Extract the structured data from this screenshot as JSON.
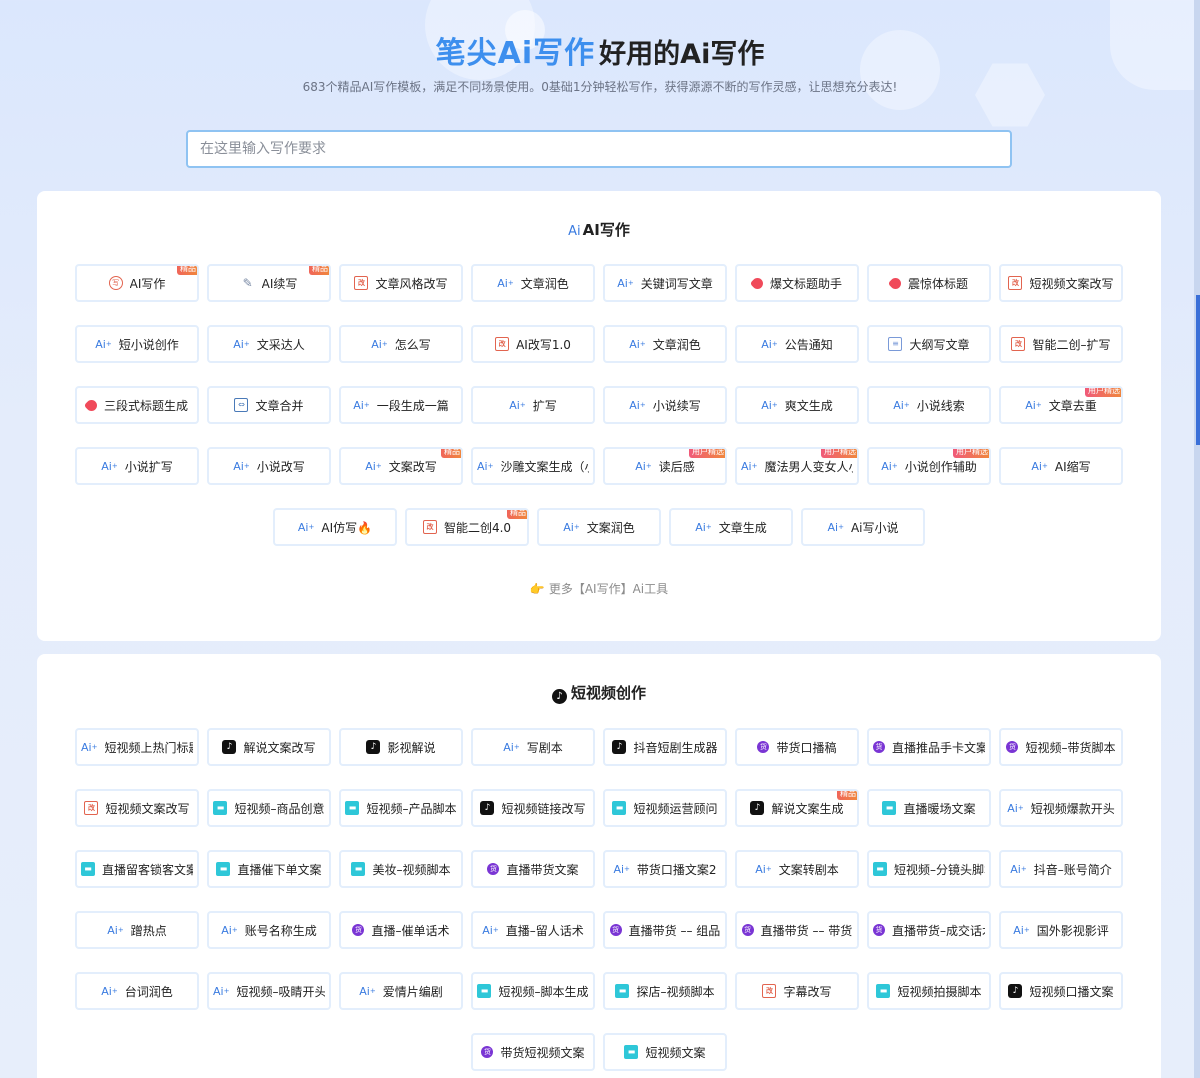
{
  "header": {
    "brand": "笔尖Ai写作",
    "title_rest": "好用的Ai写作",
    "subtitle": "683个精品AI写作模板，满足不同场景使用。0基础1分钟轻松写作，获得源源不断的写作灵感，让思想充分表达!"
  },
  "search": {
    "placeholder": "在这里输入写作要求",
    "value": ""
  },
  "sections": [
    {
      "title_prefix": "Ai",
      "title": "AI写作",
      "more": "更多【AI写作】Ai工具",
      "items": [
        {
          "label": "AI写作",
          "icon": "stamp-circle-icon",
          "badge": "精品"
        },
        {
          "label": "AI续写",
          "icon": "pen-icon",
          "badge": "精品"
        },
        {
          "label": "文章风格改写",
          "icon": "stamp-icon",
          "badge": ""
        },
        {
          "label": "文章润色",
          "icon": "ai-icon",
          "badge": ""
        },
        {
          "label": "关键词写文章",
          "icon": "ai-icon",
          "badge": ""
        },
        {
          "label": "爆文标题助手",
          "icon": "tag-icon",
          "badge": ""
        },
        {
          "label": "震惊体标题",
          "icon": "tag-icon",
          "badge": ""
        },
        {
          "label": "短视频文案改写",
          "icon": "stamp-icon",
          "badge": ""
        },
        {
          "label": "短小说创作",
          "icon": "ai-icon",
          "badge": ""
        },
        {
          "label": "文采达人",
          "icon": "ai-icon",
          "badge": ""
        },
        {
          "label": "怎么写",
          "icon": "ai-icon",
          "badge": ""
        },
        {
          "label": "AI改写1.0",
          "icon": "stamp-icon",
          "badge": ""
        },
        {
          "label": "文章润色",
          "icon": "ai-icon",
          "badge": ""
        },
        {
          "label": "公告通知",
          "icon": "ai-icon",
          "badge": ""
        },
        {
          "label": "大纲写文章",
          "icon": "document-icon",
          "badge": ""
        },
        {
          "label": "智能二创–扩写",
          "icon": "stamp-icon",
          "badge": ""
        },
        {
          "label": "三段式标题生成",
          "icon": "tag-icon",
          "badge": ""
        },
        {
          "label": "文章合并",
          "icon": "merge-icon",
          "badge": ""
        },
        {
          "label": "一段生成一篇",
          "icon": "ai-icon",
          "badge": ""
        },
        {
          "label": "扩写",
          "icon": "ai-icon",
          "badge": ""
        },
        {
          "label": "小说续写",
          "icon": "ai-icon",
          "badge": ""
        },
        {
          "label": "爽文生成",
          "icon": "ai-icon",
          "badge": ""
        },
        {
          "label": "小说线索",
          "icon": "ai-icon",
          "badge": ""
        },
        {
          "label": "文章去重",
          "icon": "ai-icon",
          "badge": "用户精选"
        },
        {
          "label": "小说扩写",
          "icon": "ai-icon",
          "badge": ""
        },
        {
          "label": "小说改写",
          "icon": "ai-icon",
          "badge": ""
        },
        {
          "label": "文案改写",
          "icon": "ai-icon",
          "badge": "精品"
        },
        {
          "label": "沙雕文案生成（小",
          "icon": "ai-icon",
          "badge": ""
        },
        {
          "label": "读后感",
          "icon": "ai-icon",
          "badge": "用户精选"
        },
        {
          "label": "魔法男人变女人小",
          "icon": "ai-icon",
          "badge": "用户精选"
        },
        {
          "label": "小说创作辅助",
          "icon": "ai-icon",
          "badge": "用户精选"
        },
        {
          "label": "AI缩写",
          "icon": "ai-icon",
          "badge": ""
        },
        {
          "label": "AI仿写🔥",
          "icon": "ai-icon",
          "badge": ""
        },
        {
          "label": "智能二创4.0",
          "icon": "stamp-icon",
          "badge": "精品"
        },
        {
          "label": "文案润色",
          "icon": "ai-icon",
          "badge": ""
        },
        {
          "label": "文章生成",
          "icon": "ai-icon",
          "badge": ""
        },
        {
          "label": "Ai写小说",
          "icon": "ai-icon",
          "badge": ""
        }
      ]
    },
    {
      "title_prefix": "",
      "title": "短视频创作",
      "items": [
        {
          "label": "短视频上热门标题",
          "icon": "ai-icon",
          "badge": ""
        },
        {
          "label": "解说文案改写",
          "icon": "tiktok-icon",
          "badge": ""
        },
        {
          "label": "影视解说",
          "icon": "tiktok-icon",
          "badge": ""
        },
        {
          "label": "写剧本",
          "icon": "ai-icon",
          "badge": ""
        },
        {
          "label": "抖音短剧生成器",
          "icon": "tiktok-icon",
          "badge": ""
        },
        {
          "label": "带货口播稿",
          "icon": "huo-icon",
          "badge": ""
        },
        {
          "label": "直播推品手卡文案",
          "icon": "huo-icon",
          "badge": ""
        },
        {
          "label": "短视频–带货脚本",
          "icon": "huo-icon",
          "badge": ""
        },
        {
          "label": "短视频文案改写",
          "icon": "stamp-icon",
          "badge": ""
        },
        {
          "label": "短视频–商品创意",
          "icon": "clapper-icon",
          "badge": ""
        },
        {
          "label": "短视频–产品脚本",
          "icon": "clapper-icon",
          "badge": ""
        },
        {
          "label": "短视频链接改写",
          "icon": "tiktok-icon",
          "badge": ""
        },
        {
          "label": "短视频运营顾问",
          "icon": "clapper-icon",
          "badge": ""
        },
        {
          "label": "解说文案生成",
          "icon": "tiktok-icon",
          "badge": "精品"
        },
        {
          "label": "直播暖场文案",
          "icon": "clapper-icon",
          "badge": ""
        },
        {
          "label": "短视频爆款开头",
          "icon": "ai-icon",
          "badge": ""
        },
        {
          "label": "直播留客锁客文案",
          "icon": "clapper-icon",
          "badge": ""
        },
        {
          "label": "直播催下单文案",
          "icon": "clapper-icon",
          "badge": ""
        },
        {
          "label": "美妆–视频脚本",
          "icon": "clapper-icon",
          "badge": ""
        },
        {
          "label": "直播带货文案",
          "icon": "huo-icon",
          "badge": ""
        },
        {
          "label": "带货口播文案2",
          "icon": "ai-icon",
          "badge": ""
        },
        {
          "label": "文案转剧本",
          "icon": "ai-icon",
          "badge": ""
        },
        {
          "label": "短视频–分镜头脚本",
          "icon": "clapper-icon",
          "badge": ""
        },
        {
          "label": "抖音–账号简介",
          "icon": "ai-icon",
          "badge": ""
        },
        {
          "label": "蹭热点",
          "icon": "ai-icon",
          "badge": ""
        },
        {
          "label": "账号名称生成",
          "icon": "ai-icon",
          "badge": ""
        },
        {
          "label": "直播–催单话术",
          "icon": "huo-icon",
          "badge": ""
        },
        {
          "label": "直播–留人话术",
          "icon": "ai-icon",
          "badge": ""
        },
        {
          "label": "直播带货 –– 组品",
          "icon": "huo-icon",
          "badge": ""
        },
        {
          "label": "直播带货 –– 带货",
          "icon": "huo-icon",
          "badge": ""
        },
        {
          "label": "直播带货–成交话术",
          "icon": "huo-icon",
          "badge": ""
        },
        {
          "label": "国外影视影评",
          "icon": "ai-icon",
          "badge": ""
        },
        {
          "label": "台词润色",
          "icon": "ai-icon",
          "badge": ""
        },
        {
          "label": "短视频–吸睛开头",
          "icon": "ai-icon",
          "badge": ""
        },
        {
          "label": "爱情片编剧",
          "icon": "ai-icon",
          "badge": ""
        },
        {
          "label": "短视频–脚本生成",
          "icon": "clapper-icon",
          "badge": ""
        },
        {
          "label": "探店–视频脚本",
          "icon": "clapper-icon",
          "badge": ""
        },
        {
          "label": "字幕改写",
          "icon": "stamp-icon",
          "badge": ""
        },
        {
          "label": "短视频拍摄脚本",
          "icon": "clapper-icon",
          "badge": ""
        },
        {
          "label": "短视频口播文案",
          "icon": "tiktok-icon",
          "badge": ""
        },
        {
          "label": "带货短视频文案",
          "icon": "huo-icon",
          "badge": ""
        },
        {
          "label": "短视频文案",
          "icon": "clapper-icon",
          "badge": ""
        }
      ]
    }
  ]
}
